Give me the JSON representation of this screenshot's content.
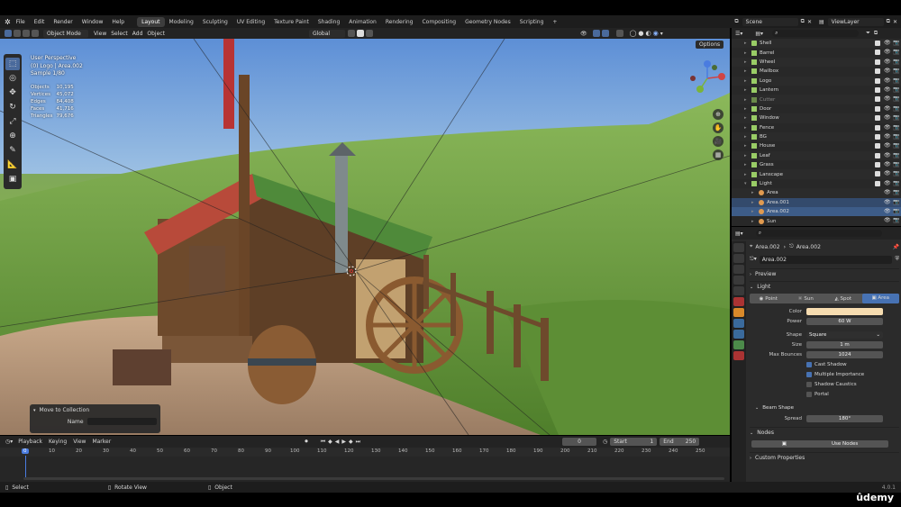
{
  "menu": [
    "File",
    "Edit",
    "Render",
    "Window",
    "Help"
  ],
  "workspaces": [
    "Layout",
    "Modeling",
    "Sculpting",
    "UV Editing",
    "Texture Paint",
    "Shading",
    "Animation",
    "Rendering",
    "Compositing",
    "Geometry Nodes",
    "Scripting"
  ],
  "active_workspace": "Layout",
  "scene": "Scene",
  "view_layer": "ViewLayer",
  "viewport_header": {
    "mode": "Object Mode",
    "menus": [
      "View",
      "Select",
      "Add",
      "Object"
    ],
    "transform": "Global",
    "options": "Options"
  },
  "viewport_info": {
    "perspective": "User Perspective",
    "object": "(0) Logo | Area.002",
    "sample": "Sample 1/80",
    "stats": [
      {
        "label": "Objects",
        "value": "10,195"
      },
      {
        "label": "Vertices",
        "value": "45,072"
      },
      {
        "label": "Edges",
        "value": "84,408"
      },
      {
        "label": "Faces",
        "value": "41,716"
      },
      {
        "label": "Triangles",
        "value": "79,676"
      }
    ]
  },
  "operator_panel": {
    "title": "Move to Collection",
    "field_label": "Name"
  },
  "timeline": {
    "menus": [
      "Playback",
      "Keying",
      "View",
      "Marker"
    ],
    "current": "0",
    "start_label": "Start",
    "start": "1",
    "end_label": "End",
    "end": "250",
    "ticks": [
      "0",
      "10",
      "20",
      "30",
      "40",
      "50",
      "60",
      "70",
      "80",
      "90",
      "100",
      "110",
      "120",
      "130",
      "140",
      "150",
      "160",
      "170",
      "180",
      "190",
      "200",
      "210",
      "220",
      "230",
      "240",
      "250"
    ]
  },
  "statusbar": {
    "select": "Select",
    "rotate": "Rotate View",
    "object": "Object",
    "version": "4.0.1"
  },
  "outliner": [
    {
      "name": "Shell",
      "sel": false
    },
    {
      "name": "Barrel",
      "sel": false
    },
    {
      "name": "Wheel",
      "sel": false
    },
    {
      "name": "Mailbox",
      "sel": false
    },
    {
      "name": "Logo",
      "sel": false
    },
    {
      "name": "Lantern",
      "sel": false
    },
    {
      "name": "Cutter",
      "sel": false
    },
    {
      "name": "Door",
      "sel": false
    },
    {
      "name": "Window",
      "sel": false
    },
    {
      "name": "Fence",
      "sel": false
    },
    {
      "name": "BG",
      "sel": false
    },
    {
      "name": "House",
      "sel": false
    },
    {
      "name": "Leaf",
      "sel": false
    },
    {
      "name": "Grass",
      "sel": false
    },
    {
      "name": "Lanscape",
      "sel": false
    },
    {
      "name": "Light",
      "sel": false
    },
    {
      "name": "Area",
      "sel": false
    },
    {
      "name": "Area.001",
      "sel": true
    },
    {
      "name": "Area.002",
      "sel": true
    },
    {
      "name": "Sun",
      "sel": false
    }
  ],
  "properties": {
    "breadcrumb_object": "Area.002",
    "breadcrumb_data": "Area.002",
    "datablock": "Area.002",
    "preview": "Preview",
    "light": "Light",
    "light_types": [
      "Point",
      "Sun",
      "Spot",
      "Area"
    ],
    "active_type": "Area",
    "color_label": "Color",
    "color": "#f6dcb0",
    "power_label": "Power",
    "power": "60 W",
    "shape_label": "Shape",
    "shape": "Square",
    "size_label": "Size",
    "size": "1 m",
    "bounces_label": "Max Bounces",
    "bounces": "1024",
    "cast_shadow": "Cast Shadow",
    "multiple_importance": "Multiple Importance",
    "shadow_caustics": "Shadow Caustics",
    "portal": "Portal",
    "beam_shape": "Beam Shape",
    "spread_label": "Spread",
    "spread": "180°",
    "nodes": "Nodes",
    "use_nodes": "Use Nodes",
    "custom_props": "Custom Properties"
  },
  "watermark": "ûdemy"
}
